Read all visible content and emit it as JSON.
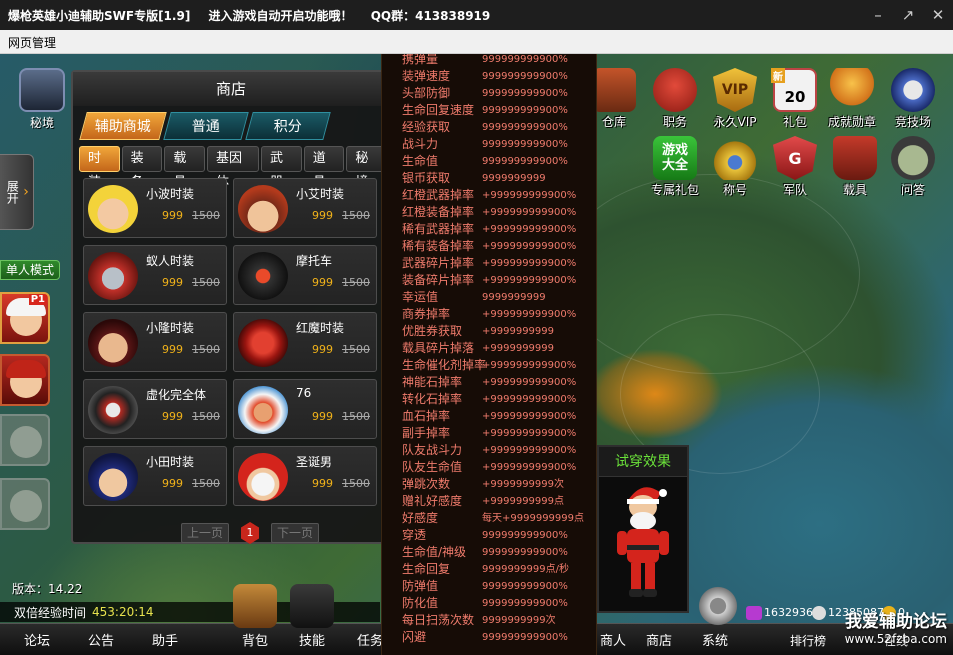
{
  "window": {
    "title_app": "爆枪英雄小迪辅助SWF专版[1.9]",
    "title_notice": "进入游戏自动开启功能哦！",
    "title_qq": "QQ群：413838919",
    "btn_min": "–",
    "btn_max": "↗",
    "btn_close": "✕"
  },
  "menu": {
    "item": "网页管理"
  },
  "left": {
    "mijing": "秘境",
    "expand": "展开",
    "single_mode": "单人模式",
    "p1_badge": "P1",
    "version": "版本：14.22",
    "double_exp_label": "双倍经验时间",
    "double_exp_time": "453:20:14"
  },
  "bottom": {
    "items": [
      "论坛",
      "公告",
      "助手",
      "背包",
      "技能",
      "任务",
      "商人",
      "商店",
      "系统",
      "排行榜",
      "在线"
    ],
    "currency1": "1632936",
    "currency2": "12385087",
    "currency3": "0"
  },
  "shop": {
    "title": "商店",
    "main_tabs": [
      "辅助商城",
      "普通",
      "积分"
    ],
    "active_main_tab": "辅助商城",
    "sub_tabs": [
      "时装",
      "装备",
      "载具",
      "基因体",
      "武器",
      "道具",
      "秘境"
    ],
    "active_sub_tab": "时装",
    "items": [
      {
        "name": "小波时装",
        "price": "999",
        "old_price": "1500"
      },
      {
        "name": "小艾时装",
        "price": "999",
        "old_price": "1500"
      },
      {
        "name": "蚁人时装",
        "price": "999",
        "old_price": "1500"
      },
      {
        "name": "摩托车",
        "price": "999",
        "old_price": "1500"
      },
      {
        "name": "小隆时装",
        "price": "999",
        "old_price": "1500"
      },
      {
        "name": "红魔时装",
        "price": "999",
        "old_price": "1500"
      },
      {
        "name": "虚化完全体",
        "price": "999",
        "old_price": "1500"
      },
      {
        "name": "76",
        "price": "999",
        "old_price": "1500"
      },
      {
        "name": "小田时装",
        "price": "999",
        "old_price": "1500"
      },
      {
        "name": "圣诞男",
        "price": "999",
        "old_price": "1500"
      }
    ],
    "pager": {
      "prev": "上一页",
      "page": "1",
      "next": "下一页"
    }
  },
  "stats": [
    {
      "k": "携弹量",
      "v": "999999999900%"
    },
    {
      "k": "装弹速度",
      "v": "999999999900%"
    },
    {
      "k": "头部防御",
      "v": "999999999900%"
    },
    {
      "k": "生命回复速度",
      "v": "999999999900%"
    },
    {
      "k": "经验获取",
      "v": "999999999900%"
    },
    {
      "k": "战斗力",
      "v": "999999999900%"
    },
    {
      "k": "生命值",
      "v": "999999999900%"
    },
    {
      "k": "银币获取",
      "v": "9999999999"
    },
    {
      "k": "红橙武器掉率",
      "v": "+999999999900%"
    },
    {
      "k": "红橙装备掉率",
      "v": "+999999999900%"
    },
    {
      "k": "稀有武器掉率",
      "v": "+999999999900%"
    },
    {
      "k": "稀有装备掉率",
      "v": "+999999999900%"
    },
    {
      "k": "武器碎片掉率",
      "v": "+999999999900%"
    },
    {
      "k": "装备碎片掉率",
      "v": "+999999999900%"
    },
    {
      "k": "幸运值",
      "v": "9999999999"
    },
    {
      "k": "商券掉率",
      "v": "+999999999900%"
    },
    {
      "k": "优胜券获取",
      "v": "+9999999999"
    },
    {
      "k": "载具碎片掉落",
      "v": "+9999999999"
    },
    {
      "k": "生命催化剂掉率",
      "v": "+999999999900%"
    },
    {
      "k": "神能石掉率",
      "v": "+999999999900%"
    },
    {
      "k": "转化石掉率",
      "v": "+999999999900%"
    },
    {
      "k": "血石掉率",
      "v": "+999999999900%"
    },
    {
      "k": "副手掉率",
      "v": "+999999999900%"
    },
    {
      "k": "队友战斗力",
      "v": "+999999999900%"
    },
    {
      "k": "队友生命值",
      "v": "+999999999900%"
    },
    {
      "k": "弹跳次数",
      "v": "+9999999999次"
    },
    {
      "k": "赠礼好感度",
      "v": "+9999999999点"
    },
    {
      "k": "好感度",
      "v": "每天+9999999999点"
    },
    {
      "k": "穿透",
      "v": "999999999900%"
    },
    {
      "k": "生命值/神级",
      "v": "999999999900%"
    },
    {
      "k": "生命回复",
      "v": "9999999999点/秒"
    },
    {
      "k": "防弹值",
      "v": "999999999900%"
    },
    {
      "k": "防化值",
      "v": "999999999900%"
    },
    {
      "k": "每日扫荡次数",
      "v": "9999999999次"
    },
    {
      "k": "闪避",
      "v": "999999999900%"
    }
  ],
  "right_icons": {
    "row1": [
      "仓库",
      "职务",
      "永久VIP",
      "礼包",
      "成就勋章",
      "竞技场"
    ],
    "row2": [
      "专属礼包",
      "称号",
      "军队",
      "载具",
      "问答"
    ],
    "vip_text": "VIP",
    "calendar_num": "20",
    "new_badge": "新",
    "game_box_line1": "游戏",
    "game_box_line2": "大全",
    "army_letter": "G"
  },
  "tryon": {
    "title": "试穿效果"
  },
  "watermark": {
    "line1": "我爱辅助论坛",
    "line2": "www.52fzba.com"
  },
  "colors": {
    "accent_orange": "#f0a63a",
    "stat_text": "#ef7b6c",
    "price": "#f0b21a",
    "tryon_title": "#6be23a"
  }
}
